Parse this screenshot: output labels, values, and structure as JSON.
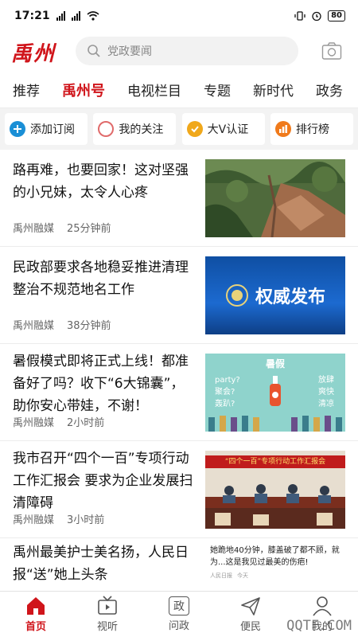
{
  "status_bar": {
    "time": "17:21",
    "battery": "80",
    "signal_label": "4G"
  },
  "header": {
    "logo": "禹州",
    "search_placeholder": "党政要闻"
  },
  "tabs": [
    "推荐",
    "禹州号",
    "电视栏目",
    "专题",
    "新时代",
    "政务"
  ],
  "active_tab": "禹州号",
  "quick_actions": [
    {
      "label": "添加订阅",
      "icon": "plus-circle-icon",
      "color": "#1a8fd6"
    },
    {
      "label": "我的关注",
      "icon": "circle-outline-icon",
      "color": "#e06a6a"
    },
    {
      "label": "大V认证",
      "icon": "check-circle-icon",
      "color": "#f0a81b"
    },
    {
      "label": "排行榜",
      "icon": "bar-chart-icon",
      "color": "#f07a1b"
    }
  ],
  "news": [
    {
      "title": "路再难，也要回家！这对坚强的小兄妹，太令人心疼",
      "source": "禹州融媒",
      "time": "25分钟前",
      "thumb": "landslide-photo"
    },
    {
      "title": "民政部要求各地稳妥推进清理整治不规范地名工作",
      "source": "禹州融媒",
      "time": "38分钟前",
      "thumb": "authority-release",
      "thumb_text": "权威发布"
    },
    {
      "title": "暑假模式即将正式上线！都准备好了吗？收下“6大锦囊”，助你安心带娃，不谢！",
      "source": "禹州融媒",
      "time": "2小时前",
      "thumb": "summer-holiday",
      "thumb_text": {
        "title": "暑假",
        "left": [
          "party?",
          "聚会?",
          "轰趴?"
        ],
        "right": [
          "放肆",
          "爽快",
          "清凉"
        ]
      }
    },
    {
      "title": "我市召开“四个一百”专项行动工作汇报会 要求为企业发展扫清障碍",
      "source": "禹州融媒",
      "time": "3小时前",
      "thumb": "meeting-photo",
      "thumb_text": "“四个一百”专项行动工作汇报会"
    },
    {
      "title": "禹州最美护士美名扬，人民日报“送”她上头条",
      "thumb": "nurse-story",
      "thumb_text": "她跪地40分钟，膝盖破了都不顾，就为...这是我见过最美的伤疤!",
      "thumb_source": "人民日报",
      "thumb_time": "今天"
    }
  ],
  "bottom_nav": [
    {
      "label": "首页",
      "icon": "home-icon",
      "active": true
    },
    {
      "label": "视听",
      "icon": "tv-icon",
      "active": false
    },
    {
      "label": "问政",
      "icon": "zheng-icon",
      "icon_char": "政",
      "active": false
    },
    {
      "label": "便民",
      "icon": "send-icon",
      "active": false
    },
    {
      "label": "我的",
      "icon": "user-icon",
      "active": false
    }
  ],
  "watermark": "QQTF.COM",
  "colors": {
    "brand_red": "#d0151b",
    "quick_bg": "#f3f3f3"
  }
}
